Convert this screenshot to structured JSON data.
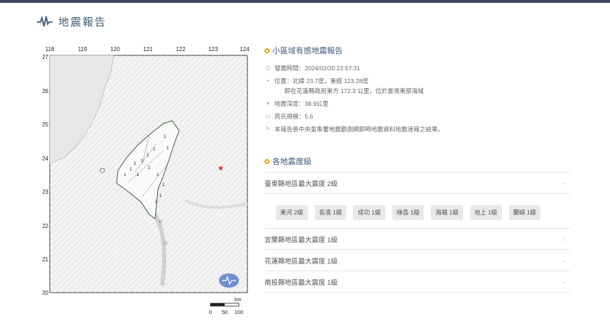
{
  "page": {
    "title": "地震報告"
  },
  "map": {
    "lon_ticks": [
      "118",
      "119",
      "120",
      "121",
      "122",
      "123",
      "124"
    ],
    "lat_ticks": [
      "27",
      "26",
      "25",
      "24",
      "23",
      "22",
      "21",
      "20"
    ],
    "scale_unit": "km",
    "scale_ticks": [
      "0",
      "50",
      "100"
    ],
    "intensity_marks": [
      "1",
      "1",
      "1",
      "1",
      "1",
      "1",
      "1",
      "1",
      "1",
      "1",
      "1",
      "1",
      "1",
      "2"
    ]
  },
  "report": {
    "section_title": "小區域有感地震報告",
    "time": "發震時間：2024/02/20 22:57:31",
    "location": "位置：北緯 23.7度，東經 123.28度",
    "location_detail": "即在花蓮縣政府東方 172.3 公里，位於臺灣東部海域",
    "depth": "地震深度：38.9公里",
    "magnitude": "芮氏規模：5.6",
    "note": "本報告係中央氣象署地震觀測網即時地震資料地震速報之結果。"
  },
  "intensity": {
    "section_title": "各地震度級",
    "regions": [
      {
        "label": "臺東縣地區最大震度 2級"
      },
      {
        "label": "宜蘭縣地區最大震度 1級"
      },
      {
        "label": "花蓮縣地區最大震度 1級"
      },
      {
        "label": "南投縣地區最大震度 1級"
      }
    ],
    "stations": [
      "東河 2級",
      "長濱 1級",
      "成功 1級",
      "綠島 1級",
      "海端 1級",
      "池上 1級",
      "蘭嶼 1級"
    ]
  },
  "colors": {
    "accent": "#e8a600",
    "title": "#3c5a78",
    "epicenter": "#e02020"
  }
}
